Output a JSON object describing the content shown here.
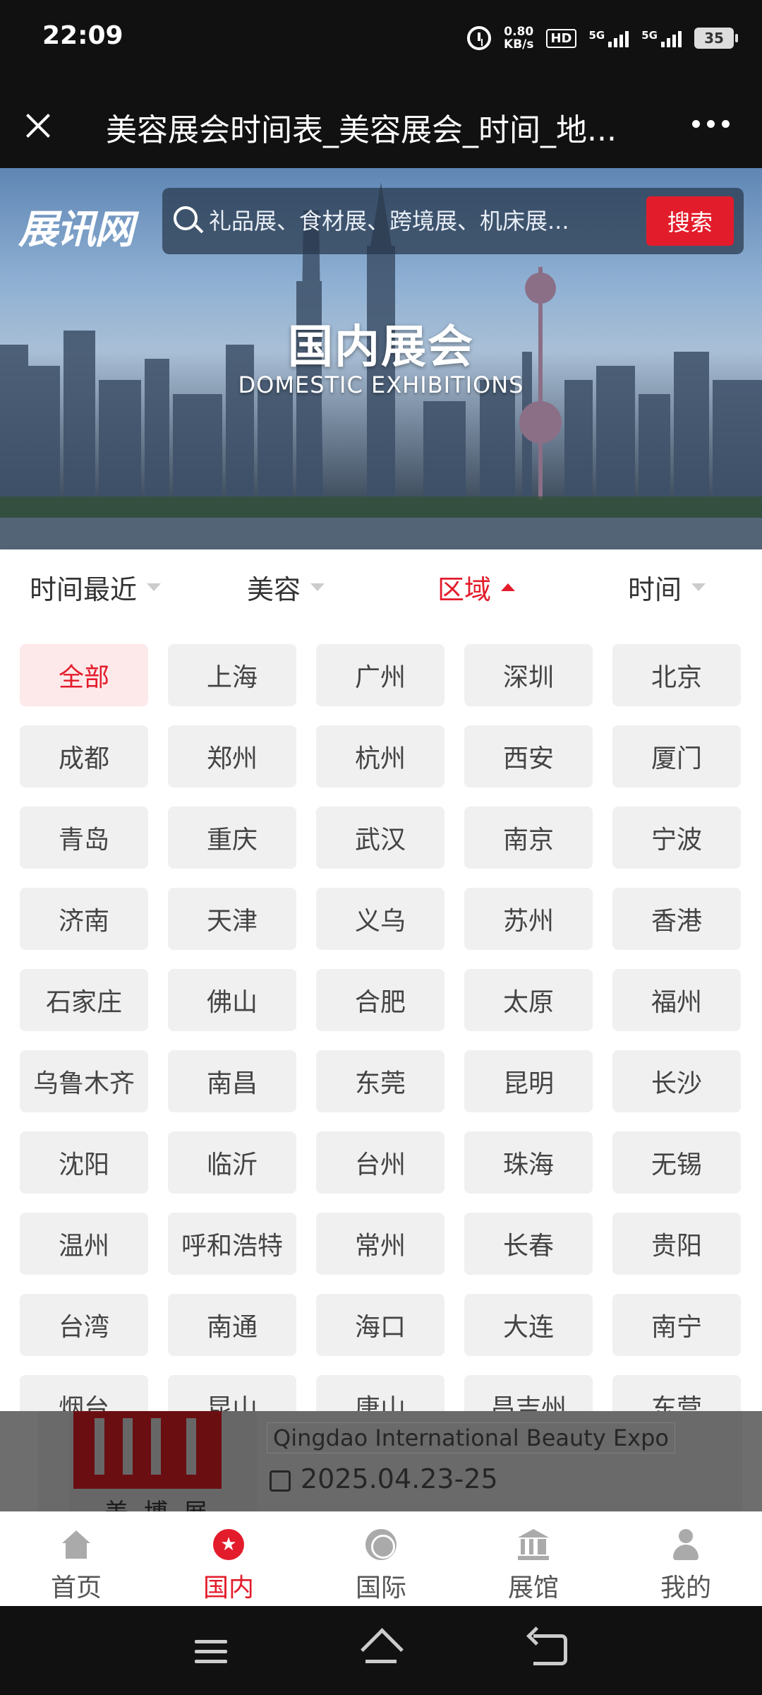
{
  "status_bar": {
    "time": "22:09",
    "net_speed_value": "0.80",
    "net_speed_unit": "KB/s",
    "hd_label": "HD",
    "signal_1": "5G",
    "signal_2": "5G",
    "battery": "35"
  },
  "title_bar": {
    "title": "美容展会时间表_美容展会_时间_地..."
  },
  "hero": {
    "logo": "展讯网",
    "search_placeholder": "礼品展、食材展、跨境展、机床展...",
    "search_button": "搜索",
    "title": "国内展会",
    "subtitle": "DOMESTIC EXHIBITIONS"
  },
  "filters": [
    {
      "label": "时间最近",
      "active": false
    },
    {
      "label": "美容",
      "active": false
    },
    {
      "label": "区域",
      "active": true
    },
    {
      "label": "时间",
      "active": false
    }
  ],
  "regions": [
    "全部",
    "上海",
    "广州",
    "深圳",
    "北京",
    "成都",
    "郑州",
    "杭州",
    "西安",
    "厦门",
    "青岛",
    "重庆",
    "武汉",
    "南京",
    "宁波",
    "济南",
    "天津",
    "义乌",
    "苏州",
    "香港",
    "石家庄",
    "佛山",
    "合肥",
    "太原",
    "福州",
    "乌鲁木齐",
    "南昌",
    "东莞",
    "昆明",
    "长沙",
    "沈阳",
    "临沂",
    "台州",
    "珠海",
    "无锡",
    "温州",
    "呼和浩特",
    "常州",
    "长春",
    "贵阳",
    "台湾",
    "南通",
    "海口",
    "大连",
    "南宁",
    "烟台",
    "昆山",
    "唐山",
    "昌吉州",
    "东营"
  ],
  "selected_region": "全部",
  "card": {
    "logo_caption": "美博展",
    "english_name": "Qingdao International Beauty Expo",
    "date": "2025.04.23-25"
  },
  "tabs": [
    {
      "label": "首页",
      "icon": "home-icon",
      "active": false
    },
    {
      "label": "国内",
      "icon": "star-icon",
      "active": true
    },
    {
      "label": "国际",
      "icon": "globe-icon",
      "active": false
    },
    {
      "label": "展馆",
      "icon": "bank-icon",
      "active": false
    },
    {
      "label": "我的",
      "icon": "user-icon",
      "active": false
    }
  ],
  "colors": {
    "accent": "#e31c2b",
    "selected_bg": "#fde9ea",
    "chip_bg": "#f0f0f0"
  }
}
